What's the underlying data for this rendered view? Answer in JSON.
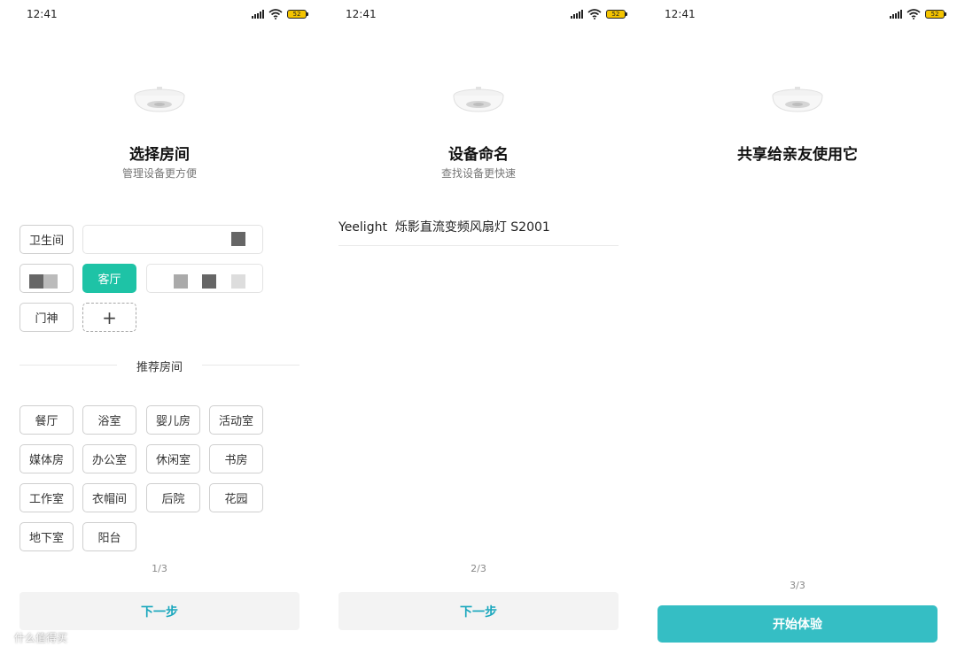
{
  "screens": [
    {
      "status": {
        "time": "12:41",
        "battery": "52"
      },
      "title": "选择房间",
      "subtitle": "管理设备更方便",
      "my_rooms": [
        {
          "label": "卫生间",
          "selected": false
        },
        {
          "label": "",
          "selected": false
        },
        {
          "label": "",
          "selected": false
        },
        {
          "label": "客厅",
          "selected": true
        },
        {
          "label": "",
          "selected": false
        },
        {
          "label": "门神",
          "selected": false
        },
        {
          "label": "+",
          "selected": false
        }
      ],
      "recommended_label": "推荐房间",
      "recommended_rooms": [
        "餐厅",
        "浴室",
        "婴儿房",
        "活动室",
        "媒体房",
        "办公室",
        "休闲室",
        "书房",
        "工作室",
        "衣帽间",
        "后院",
        "花园",
        "地下室",
        "阳台"
      ],
      "pager": "1/3",
      "next_label": "下一步"
    },
    {
      "status": {
        "time": "12:41",
        "battery": "52"
      },
      "title": "设备命名",
      "subtitle": "查找设备更快速",
      "device_name": "Yeelight  烁影直流变频风扇灯 S2001",
      "pager": "2/3",
      "next_label": "下一步"
    },
    {
      "status": {
        "time": "12:41",
        "battery": "52"
      },
      "title": "共享给亲友使用它",
      "pager": "3/3",
      "start_label": "开始体验"
    }
  ],
  "watermark": "什么值得买",
  "colors": {
    "accent_green": "#1ec3a6",
    "button_teal": "#35bec4",
    "link_blue": "#1aa7bd"
  },
  "icons": [
    "signal-icon",
    "wifi-icon",
    "battery-icon",
    "ceiling-fan-light-icon",
    "add-icon"
  ]
}
